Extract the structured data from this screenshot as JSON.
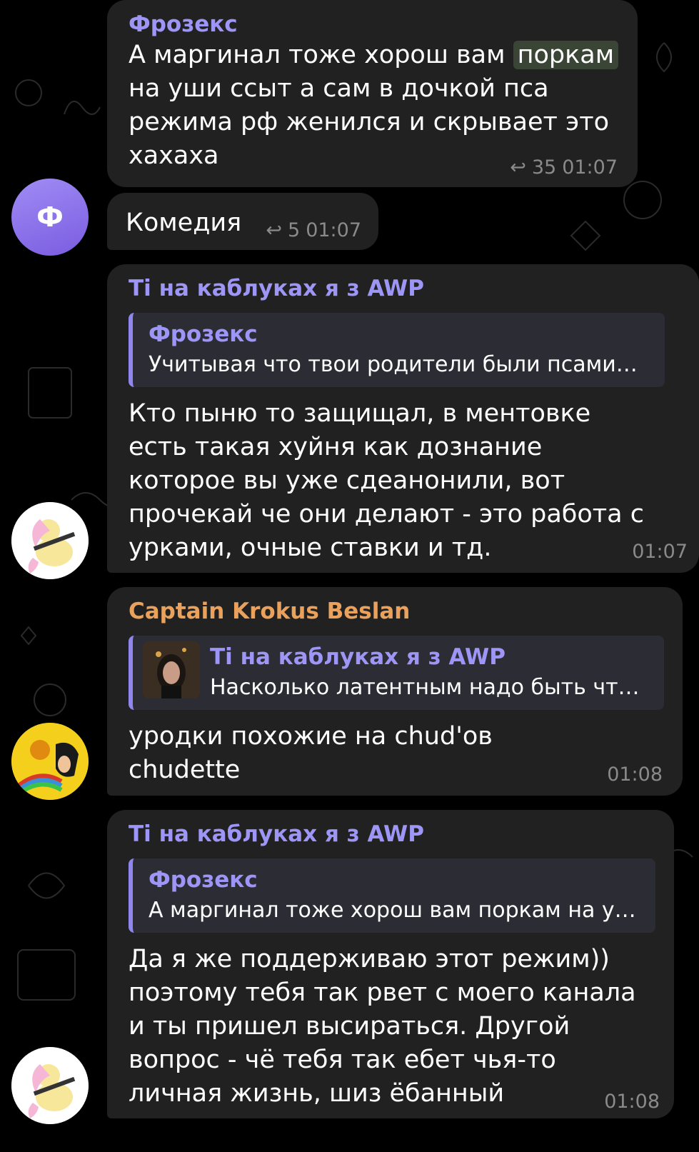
{
  "colors": {
    "background": "#000000",
    "bubble": "#212121",
    "reply_box": "#2c2c35",
    "name_purple": "#9e96f7",
    "name_orange": "#e9a15c",
    "meta_gray": "#8a8a8a"
  },
  "messages": [
    {
      "sender": "Фрозекс",
      "text_before": "А маргинал тоже хорош вам ",
      "text_highlight": "поркам",
      "text_after": "\nна уши ссыт а сам в дочкой пса\nрежима рф женился и скрывает это\nхахаха",
      "reply_count": "35",
      "time": "01:07"
    },
    {
      "avatar_letter": "Ф",
      "text": "Комедия",
      "reply_count": "5",
      "time": "01:07"
    },
    {
      "sender": "Ті на каблуках я з AWP",
      "reply_to_name": "Фрозекс",
      "reply_to_text": "Учитывая что твои родители были псами…",
      "text": "Кто пыню то защищал, в ментовке\nесть такая хуйня как дознание\nкоторое вы уже сдеанонили, вот\nпрочекай че они делают - это работа с\nурками, очные ставки и тд.",
      "time": "01:07"
    },
    {
      "sender": "Captain Krokus Beslan",
      "reply_to_name": "Ті на каблуках я з AWP",
      "reply_to_text": "Насколько латентным надо быть чт…",
      "text": "уродки похожие на chud'ов\nchudette",
      "time": "01:08"
    },
    {
      "sender": "Ті на каблуках я з AWP",
      "reply_to_name": "Фрозекс",
      "reply_to_text": "А маргинал тоже хорош вам поркам на у…",
      "text": "Да я же поддерживаю этот режим))\nпоэтому тебя так рвет с моего канала\nи ты пришел высираться. Другой\nвопрос - чё тебя так ебет чья-то\nличная жизнь, шиз ёбанный",
      "time": "01:08"
    }
  ]
}
